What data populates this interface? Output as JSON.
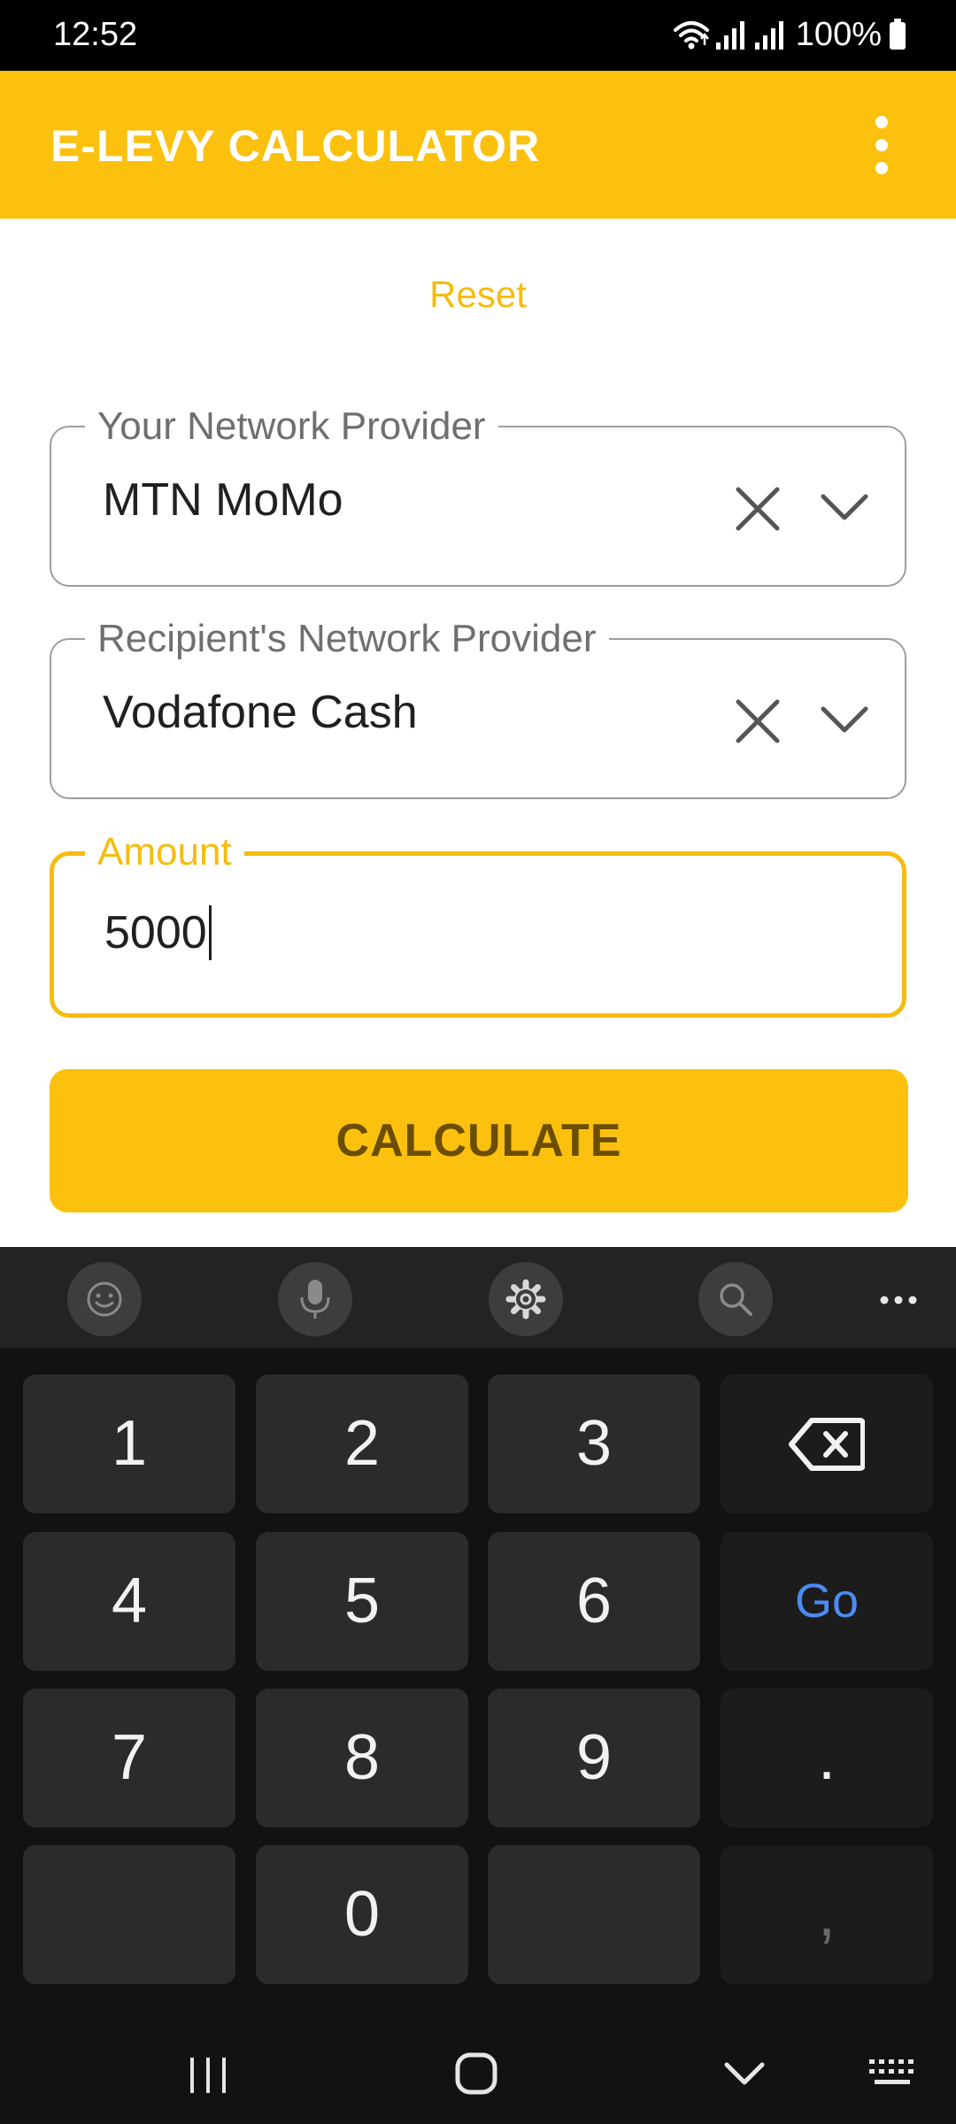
{
  "status_bar": {
    "time": "12:52",
    "battery": "100%",
    "icons": [
      "wifi-icon",
      "signal-icon",
      "signal-icon",
      "battery-icon"
    ]
  },
  "app_bar": {
    "title": "E-LEVY CALCULATOR",
    "menu_icon": "more-vertical-icon",
    "background_color": "#FCC10E"
  },
  "form": {
    "reset_label": "Reset",
    "your_provider": {
      "label": "Your Network Provider",
      "value": "MTN MoMo"
    },
    "recipient_provider": {
      "label": "Recipient's Network Provider",
      "value": "Vodafone Cash"
    },
    "amount": {
      "label": "Amount",
      "value": "5000"
    },
    "calculate_label": "CALCULATE",
    "accent_color": "#F5BC10"
  },
  "keyboard": {
    "toolbar_icons": [
      "emoji-icon",
      "microphone-icon",
      "settings-icon",
      "search-icon",
      "more-horizontal-icon"
    ],
    "keys": {
      "k1": "1",
      "k2": "2",
      "k3": "3",
      "k4": "4",
      "k5": "5",
      "k6": "6",
      "k7": "7",
      "k8": "8",
      "k9": "9",
      "k0": "0",
      "go": "Go",
      "period": ".",
      "comma": ","
    },
    "go_color": "#4a8cf2"
  },
  "nav_bar": {
    "icons": [
      "recent-apps-icon",
      "home-icon",
      "back-icon",
      "keyboard-switch-icon"
    ]
  }
}
